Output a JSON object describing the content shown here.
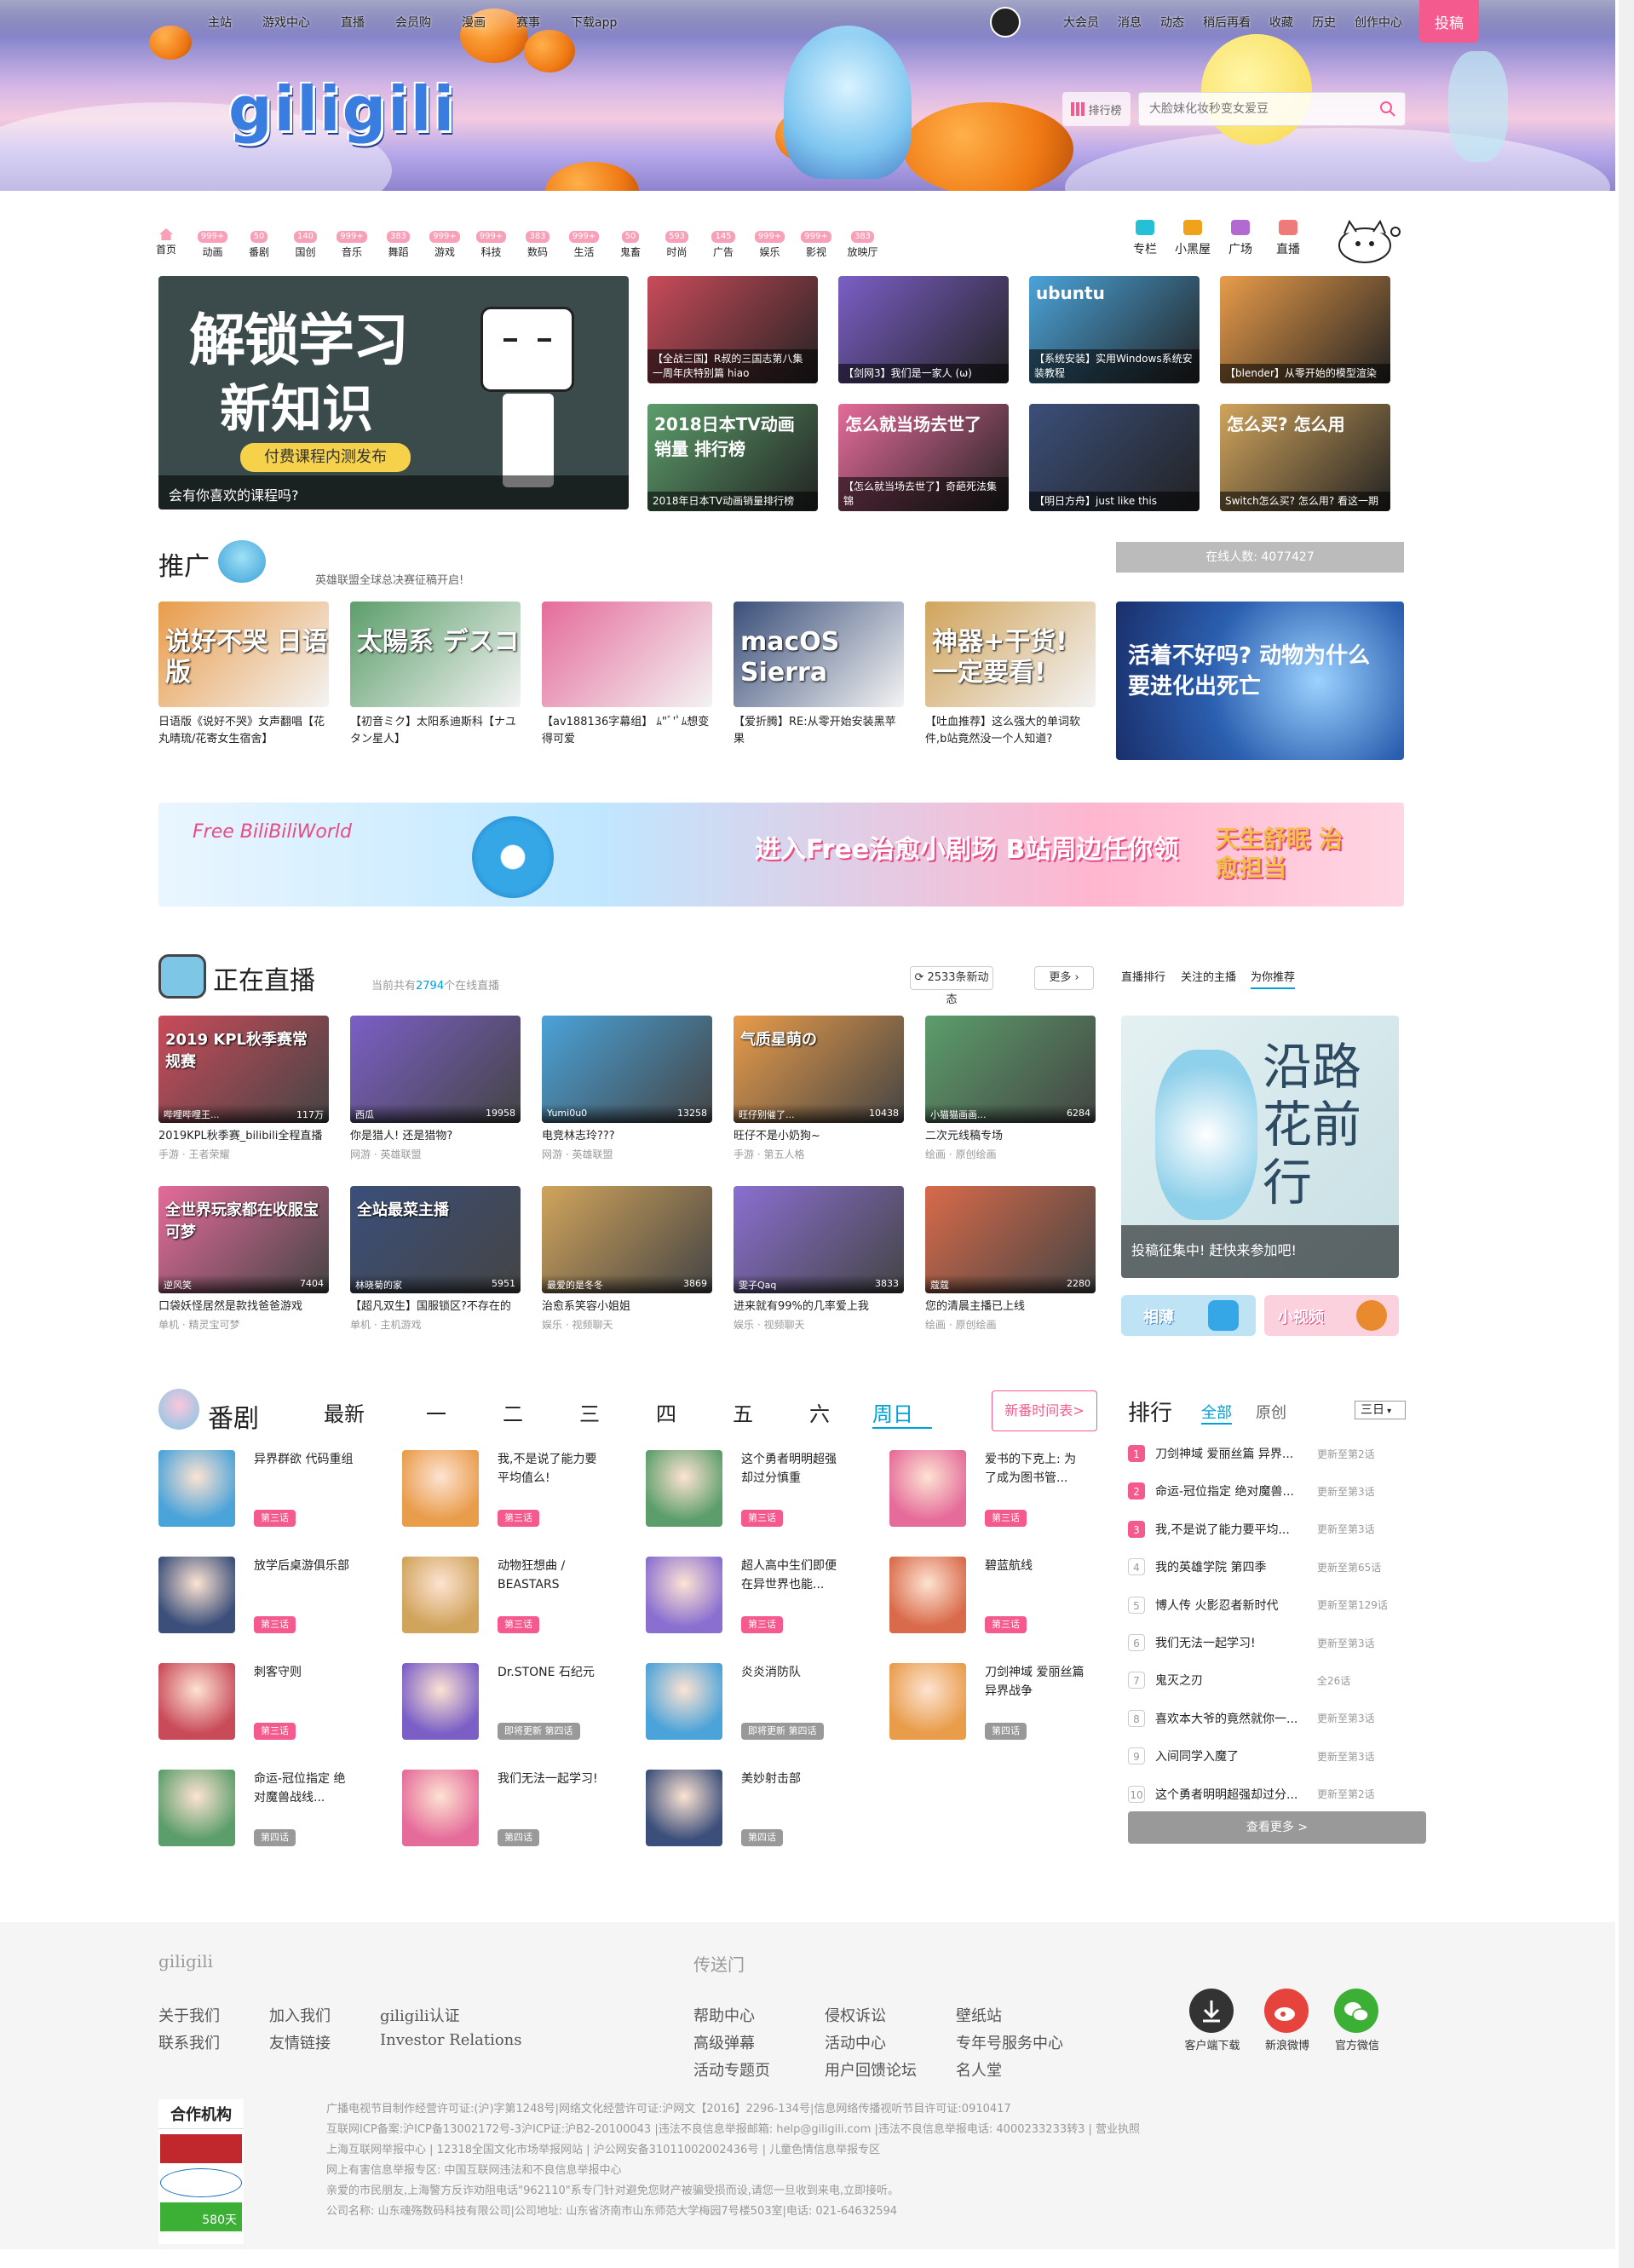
{
  "header": {
    "nav_left": [
      "主站",
      "游戏中心",
      "直播",
      "会员购",
      "漫画",
      "赛事",
      "下载app"
    ],
    "nav_right": [
      "大会员",
      "消息",
      "动态",
      "稍后再看",
      "收藏",
      "历史",
      "创作中心"
    ],
    "upload_label": "投稿",
    "logo_text": "giligili",
    "rank_label": "排行榜",
    "search_placeholder": "大脸妹化妆秒变女爱豆"
  },
  "channels": [
    {
      "label": "首页",
      "badge": ""
    },
    {
      "label": "动画",
      "badge": "999+"
    },
    {
      "label": "番剧",
      "badge": "50"
    },
    {
      "label": "国创",
      "badge": "140"
    },
    {
      "label": "音乐",
      "badge": "999+"
    },
    {
      "label": "舞蹈",
      "badge": "383"
    },
    {
      "label": "游戏",
      "badge": "999+"
    },
    {
      "label": "科技",
      "badge": "999+"
    },
    {
      "label": "数码",
      "badge": "383"
    },
    {
      "label": "生活",
      "badge": "999+"
    },
    {
      "label": "鬼畜",
      "badge": "50"
    },
    {
      "label": "时尚",
      "badge": "593"
    },
    {
      "label": "广告",
      "badge": "145"
    },
    {
      "label": "娱乐",
      "badge": "999+"
    },
    {
      "label": "影视",
      "badge": "999+"
    },
    {
      "label": "放映厅",
      "badge": "383"
    }
  ],
  "channels_right": [
    "专栏",
    "小黑屋",
    "广场",
    "直播"
  ],
  "carousel": {
    "image_text_1": "解锁学习",
    "image_text_2": "新知识",
    "image_text_3": "付费课程内测发布",
    "caption": "会有你喜欢的课程吗?"
  },
  "featured": [
    "【全战三国】R叔的三国志第八集 一周年庆特别篇 hiao",
    "【剑网3】我们是一家人 (ω)",
    "【系统安装】实用Windows系统安装教程",
    "【blender】从零开始的模型渲染",
    "2018年日本TV动画销量排行榜",
    "【怎么就当场去世了】奇葩死法集锦",
    "【明日方舟】just like this",
    "Switch怎么买? 怎么用? 看这一期"
  ],
  "featured_images": [
    "",
    "",
    "ubuntu",
    "",
    "2018日本TV动画 销量 排行榜",
    "怎么就当场去世了",
    "",
    "怎么买? 怎么用"
  ],
  "promo": {
    "title": "推广",
    "subtitle": "英雄联盟全球总决赛征稿开启!",
    "online": "在线人数: 4077427",
    "items": [
      {
        "title": "日语版《说好不哭》女声翻唱【花丸晴琉/花寄女生宿舍】",
        "img_text": "说好不哭 日语版"
      },
      {
        "title": "【初音ミク】太阳系迪斯科【ナユタン星人】",
        "img_text": "太陽系 デスコ"
      },
      {
        "title": "【av188136字幕组】 ﾑ\"ﾞ'ﾟﾑ想变得可爱",
        "img_text": ""
      },
      {
        "title": "【爱折腾】RE:从零开始安装黑苹果",
        "img_text": "macOS Sierra"
      },
      {
        "title": "【吐血推荐】这么强大的单词软件,b站竟然没一个人知道?",
        "img_text": "神器+干货! 一定要看!"
      }
    ],
    "side_ad_text": "活着不好吗? 动物为什么要进化出死亡"
  },
  "wide_ad": {
    "text": "进入Free治愈小剧场 B站周边任你领",
    "tag": "天生舒眠 治愈担当",
    "brand": "Free BiliBiliWorld"
  },
  "live": {
    "title": "正在直播",
    "count_prefix": "当前共有",
    "count": "2794",
    "count_suffix": "个在线直播",
    "news_btn": "2533条新动态",
    "more_btn": "更多",
    "tabs": [
      "直播排行",
      "关注的主播",
      "为你推荐"
    ],
    "items": [
      {
        "title": "2019KPL秋季赛_bilibili全程直播",
        "sub": "手游 · 王者荣耀",
        "host": "哔哩哔哩王...",
        "viewers": "117万"
      },
      {
        "title": "你是猎人! 还是猎物?",
        "sub": "网游 · 英雄联盟",
        "host": "西瓜",
        "viewers": "19958"
      },
      {
        "title": "电竞林志玲???",
        "sub": "网游 · 英雄联盟",
        "host": "Yumi0u0",
        "viewers": "13258"
      },
      {
        "title": "旺仔不是小奶狗~",
        "sub": "手游 · 第五人格",
        "host": "旺仔别催了...",
        "viewers": "10438"
      },
      {
        "title": "二次元线稿专场",
        "sub": "绘画 · 原创绘画",
        "host": "小猫猫画画...",
        "viewers": "6284"
      },
      {
        "title": "口袋妖怪居然是款找爸爸游戏",
        "sub": "单机 · 精灵宝可梦",
        "host": "逆风笑",
        "viewers": "7404"
      },
      {
        "title": "【超凡双生】国服锁区?不存在的",
        "sub": "单机 · 主机游戏",
        "host": "林晓菊的家",
        "viewers": "5951"
      },
      {
        "title": "治愈系笑容小姐姐",
        "sub": "娱乐 · 视频聊天",
        "host": "最爱的是冬冬",
        "viewers": "3869"
      },
      {
        "title": "进来就有99%的几率爱上我",
        "sub": "娱乐 · 视频聊天",
        "host": "雯子Qaq",
        "viewers": "3833"
      },
      {
        "title": "您的清晨主播已上线",
        "sub": "绘画 · 原创绘画",
        "host": "蔻蔻",
        "viewers": "2280"
      }
    ],
    "live_img_texts": [
      "2019 KPL秋季赛常规赛",
      "",
      "",
      "气质星萌の",
      "",
      "全世界玩家都在收服宝可梦",
      "全站最菜主播",
      "",
      "",
      ""
    ],
    "side_caption": "投稿征集中! 赶快来参加吧!",
    "side_img_text": "沿路花前行",
    "side_buttons": [
      "相薄",
      "小视频"
    ]
  },
  "bangumi": {
    "title": "番剧",
    "days": [
      "最新",
      "一",
      "二",
      "三",
      "四",
      "五",
      "六",
      "周日"
    ],
    "schedule_btn": "新番时间表>",
    "items": [
      {
        "title": "异界群欲 代码重组",
        "ep": "第三话"
      },
      {
        "title": "我,不是说了能力要平均值么!",
        "ep": "第三话"
      },
      {
        "title": "这个勇者明明超强却过分慎重",
        "ep": "第三话"
      },
      {
        "title": "爱书的下克上: 为了成为图书管...",
        "ep": "第三话"
      },
      {
        "title": "放学后桌游俱乐部",
        "ep": "第三话"
      },
      {
        "title": "动物狂想曲 / BEASTARS",
        "ep": "第三话"
      },
      {
        "title": "超人高中生们即便在异世界也能...",
        "ep": "第三话"
      },
      {
        "title": "碧蓝航线",
        "ep": "第三话"
      },
      {
        "title": "刺客守则",
        "ep": "第三话"
      },
      {
        "title": "Dr.STONE 石纪元",
        "ep": "即将更新 第四话"
      },
      {
        "title": "炎炎消防队",
        "ep": "即将更新 第四话"
      },
      {
        "title": "刀剑神域 爱丽丝篇 异界战争",
        "ep": "第四话"
      },
      {
        "title": "命运-冠位指定 绝对魔兽战线...",
        "ep": "第四话"
      },
      {
        "title": "我们无法一起学习!",
        "ep": "第四话"
      },
      {
        "title": "美妙射击部",
        "ep": "第四话"
      }
    ]
  },
  "ranking": {
    "title": "排行",
    "tabs": [
      "全部",
      "原创"
    ],
    "period": "三日",
    "more": "查看更多 >",
    "items": [
      {
        "rank": "1",
        "name": "刀剑神域 爱丽丝篇 异界...",
        "update": "更新至第2话"
      },
      {
        "rank": "2",
        "name": "命运-冠位指定 绝对魔兽...",
        "update": "更新至第3话"
      },
      {
        "rank": "3",
        "name": "我,不是说了能力要平均...",
        "update": "更新至第3话"
      },
      {
        "rank": "4",
        "name": "我的英雄学院 第四季",
        "update": "更新至第65话"
      },
      {
        "rank": "5",
        "name": "博人传 火影忍者新时代",
        "update": "更新至第129话"
      },
      {
        "rank": "6",
        "name": "我们无法一起学习!",
        "update": "更新至第3话"
      },
      {
        "rank": "7",
        "name": "鬼灭之刃",
        "update": "全26话"
      },
      {
        "rank": "8",
        "name": "喜欢本大爷的竟然就你一...",
        "update": "更新至第3话"
      },
      {
        "rank": "9",
        "name": "入间同学入魔了",
        "update": "更新至第3话"
      },
      {
        "rank": "10",
        "name": "这个勇者明明超强却过分...",
        "update": "更新至第2话"
      }
    ]
  },
  "footer": {
    "col1_title": "giligili",
    "col1_links": [
      "关于我们",
      "加入我们",
      "giligili认证",
      "联系我们",
      "友情链接",
      "Investor Relations"
    ],
    "col2_title": "传送门",
    "col2_links": [
      "帮助中心",
      "侵权诉讼",
      "壁纸站",
      "高级弹幕",
      "活动中心",
      "专年号服务中心",
      "活动专题页",
      "用户回馈论坛",
      "名人堂"
    ],
    "social": [
      "客户端下载",
      "新浪微博",
      "官方微信"
    ],
    "partner_title": "合作机构",
    "badge_days": "580天",
    "legal": [
      "广播电视节目制作经营许可证:(沪)字第1248号|网络文化经营许可证:沪网文【2016】2296-134号|信息网络传播视听节目许可证:0910417",
      "互联网ICP备案:沪ICP备13002172号-3沪ICP证:沪B2-20100043 |违法不良信息举报邮箱: help@giligili.com |违法不良信息举报电话: 4000233233转3 | 营业执照",
      "上海互联网举报中心 | 12318全国文化市场举报网站 | 沪公网安备31011002002436号 | 儿童色情信息举报专区",
      "网上有害信息举报专区: 中国互联网违法和不良信息举报中心",
      "亲爱的市民朋友,上海警方反诈劝阻电话\"962110\"系专门针对避免您财产被骗受损而设,请您一旦收到来电,立即接听。",
      "公司名称: 山东魂殇数码科技有限公司|公司地址: 山东省济南市山东师范大学梅园7号楼503室|电话: 021-64632594"
    ]
  },
  "colors": {
    "accent": "#f45a8d",
    "blue": "#00a1d6",
    "footer_bg": "#f5f5f5"
  }
}
